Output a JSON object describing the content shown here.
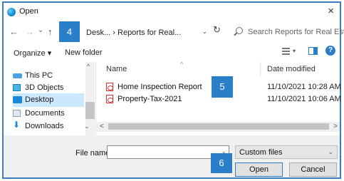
{
  "window": {
    "title": "Open",
    "close_glyph": "×"
  },
  "nav": {
    "back_glyph": "←",
    "forward_glyph": "→",
    "recent_glyph": "⌄",
    "up_glyph": "↑",
    "address_text": "Desk...  ›  Reports for Real...",
    "address_dropdown_glyph": "⌄",
    "refresh_glyph": "↻",
    "search_placeholder": "Search Reports for Real Estat..."
  },
  "badges": {
    "step4": "4",
    "step5": "5",
    "step6": "6"
  },
  "toolbar": {
    "organize_label": "Organize ▾",
    "new_folder_label": "New folder",
    "view_drop_glyph": "▾",
    "help_glyph": "?"
  },
  "sidebar": {
    "items": [
      {
        "label": "This PC",
        "icon": "computer-icon"
      },
      {
        "label": "3D Objects",
        "icon": "3d-objects-icon"
      },
      {
        "label": "Desktop",
        "icon": "desktop-icon",
        "selected": true
      },
      {
        "label": "Documents",
        "icon": "documents-icon"
      },
      {
        "label": "Downloads",
        "icon": "downloads-icon"
      }
    ],
    "scroll_up_glyph": "^",
    "scroll_down_glyph": "⌄"
  },
  "columns": {
    "name": "Name",
    "date": "Date modified",
    "sort_glyph": "^"
  },
  "files": [
    {
      "name": "Home Inspection Report",
      "date": "11/10/2021 10:28 AM",
      "icon": "pdf-icon"
    },
    {
      "name": "Property-Tax-2021",
      "date": "11/10/2021 10:06 AM",
      "icon": "pdf-icon"
    }
  ],
  "hscroll": {
    "left_glyph": "<",
    "right_glyph": ">"
  },
  "footer": {
    "filename_label": "File name:",
    "filename_value": "",
    "filename_drop_glyph": "⌄",
    "filter_value": "Custom files",
    "filter_drop_glyph": "⌄",
    "open_label": "Open",
    "cancel_label": "Cancel"
  },
  "colors": {
    "accent": "#2b7fc9",
    "selection": "#cce8ff",
    "pdf": "#dd3333"
  }
}
